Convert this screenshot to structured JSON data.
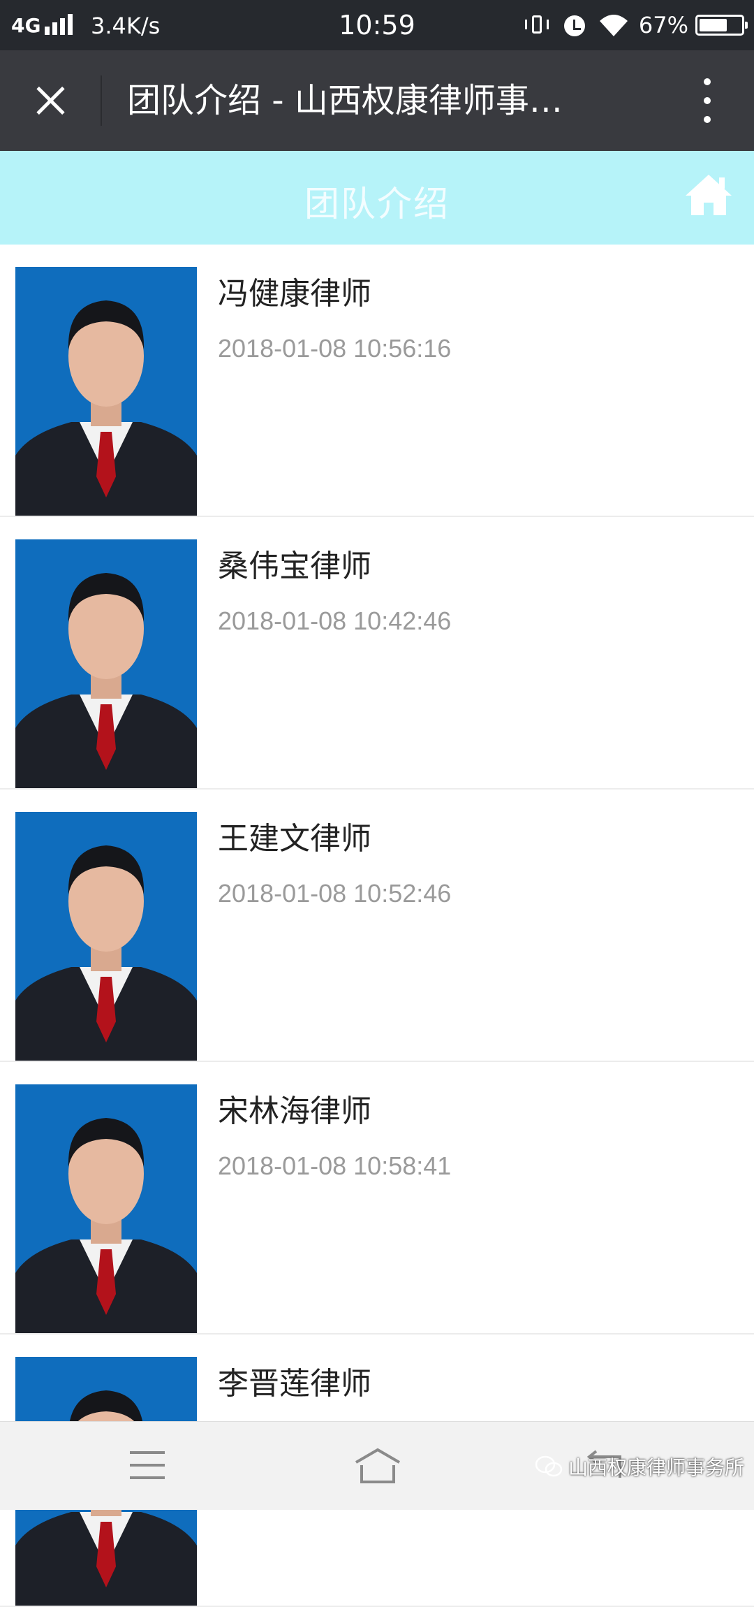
{
  "status_bar": {
    "network": "4G",
    "speed": "3.4K/s",
    "time": "10:59",
    "battery_pct": "67%",
    "battery_level": 0.67
  },
  "titlebar": {
    "title": "团队介绍 - 山西权康律师事…"
  },
  "header": {
    "title": "团队介绍"
  },
  "lawyers": [
    {
      "name": "冯健康律师",
      "date": "2018-01-08 10:56:16"
    },
    {
      "name": "桑伟宝律师",
      "date": "2018-01-08 10:42:46"
    },
    {
      "name": "王建文律师",
      "date": "2018-01-08 10:52:46"
    },
    {
      "name": "宋林海律师",
      "date": "2018-01-08 10:58:41"
    },
    {
      "name": "李晋莲律师",
      "date": ""
    }
  ],
  "watermark": {
    "text": "山西权康律师事务所"
  },
  "colors": {
    "header_bg": "#b6f3f9",
    "titlebar_bg": "#393a3f",
    "photo_bg": "#0f6dbd"
  }
}
